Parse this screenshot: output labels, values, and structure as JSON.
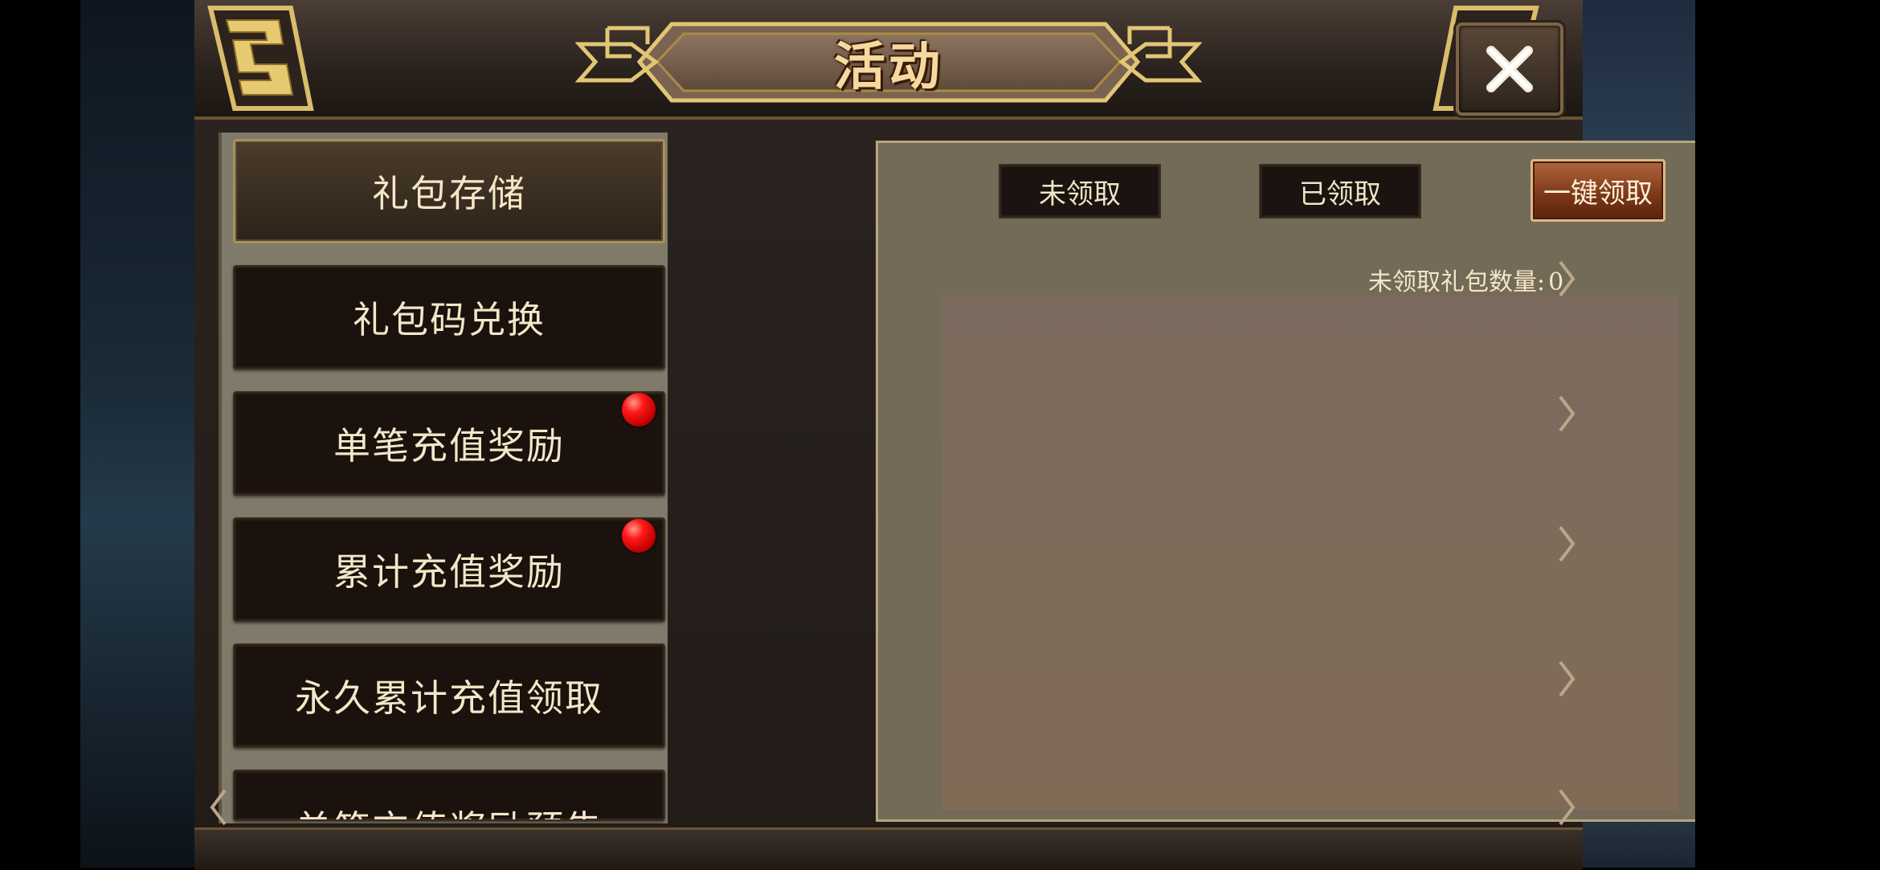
{
  "header": {
    "title": "活动",
    "close_icon": "close-x-icon"
  },
  "sidebar": {
    "items": [
      {
        "label": "礼包存储",
        "active": true,
        "badge": false
      },
      {
        "label": "礼包码兑换",
        "active": false,
        "badge": false
      },
      {
        "label": "单笔充值奖励",
        "active": false,
        "badge": true
      },
      {
        "label": "累计充值奖励",
        "active": false,
        "badge": true
      },
      {
        "label": "永久累计充值领取",
        "active": false,
        "badge": false
      },
      {
        "label": "单笔充值奖励预告",
        "active": false,
        "badge": false
      }
    ]
  },
  "content": {
    "tabs": {
      "unclaimed": "未领取",
      "claimed": "已领取",
      "claim_all": "一键领取"
    },
    "count_label": "未领取礼包数量:",
    "count_value": "0"
  },
  "colors": {
    "title_text": "#f6d9a0",
    "gold_frame": "#c9ad63",
    "panel_bg": "#736a57",
    "button_dark": "#1a1310",
    "claim_button": "#7b3618",
    "badge_red": "#ff1a1a"
  }
}
